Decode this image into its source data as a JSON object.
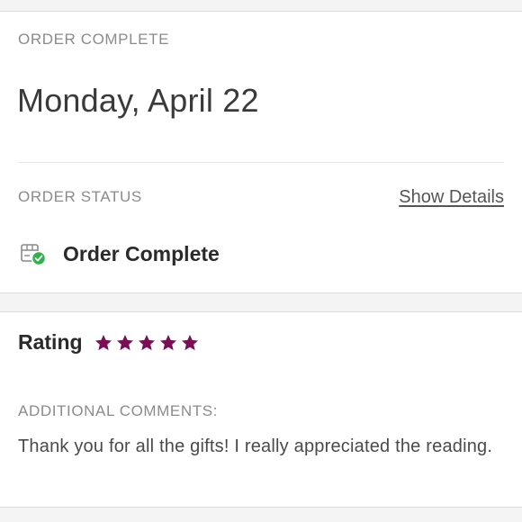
{
  "order": {
    "section_label": "ORDER COMPLETE",
    "date": "Monday, April 22",
    "status_label": "ORDER STATUS",
    "show_details": "Show Details",
    "status_text": "Order Complete",
    "status_icon": "package-check-icon"
  },
  "rating": {
    "label": "Rating",
    "stars": 5,
    "max_stars": 5,
    "star_color": "#7a0f57",
    "comments_label": "ADDITIONAL COMMENTS:",
    "comments": "Thank you for all the gifts! I really appreciated the reading."
  },
  "colors": {
    "status_check": "#2fb24a"
  }
}
